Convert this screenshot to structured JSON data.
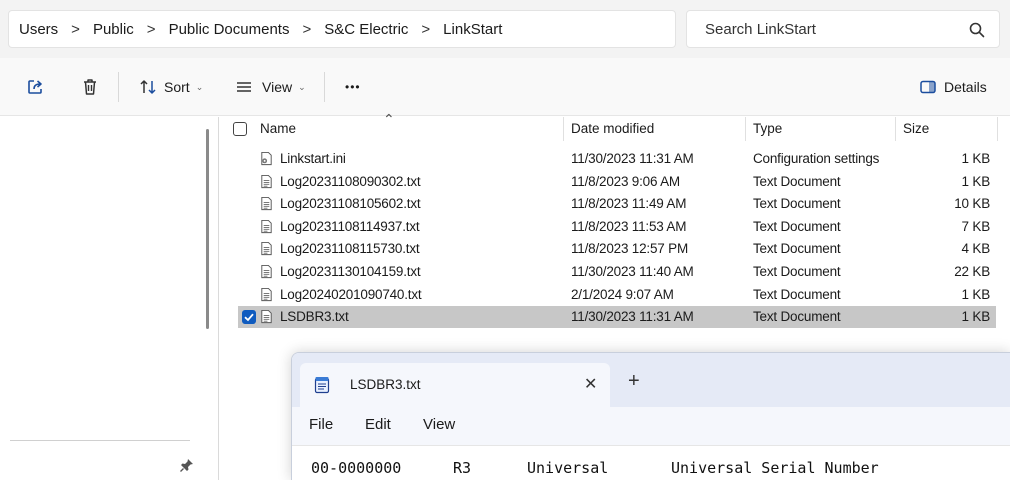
{
  "breadcrumb": [
    "Users",
    "Public",
    "Public Documents",
    "S&C Electric",
    "LinkStart"
  ],
  "breadcrumb_separator": ">",
  "search": {
    "placeholder": "Search LinkStart"
  },
  "toolbar": {
    "sort_label": "Sort",
    "view_label": "View",
    "more_label": "•••",
    "details_label": "Details"
  },
  "columns": {
    "name": "Name",
    "date": "Date modified",
    "type": "Type",
    "size": "Size"
  },
  "files": [
    {
      "name": "Linkstart.ini",
      "date": "11/30/2023 11:31 AM",
      "type": "Configuration settings",
      "size": "1 KB",
      "icon": "settings-file-icon"
    },
    {
      "name": "Log20231108090302.txt",
      "date": "11/8/2023 9:06 AM",
      "type": "Text Document",
      "size": "1 KB",
      "icon": "text-file-icon"
    },
    {
      "name": "Log20231108105602.txt",
      "date": "11/8/2023 11:49 AM",
      "type": "Text Document",
      "size": "10 KB",
      "icon": "text-file-icon"
    },
    {
      "name": "Log20231108114937.txt",
      "date": "11/8/2023 11:53 AM",
      "type": "Text Document",
      "size": "7 KB",
      "icon": "text-file-icon"
    },
    {
      "name": "Log20231108115730.txt",
      "date": "11/8/2023 12:57 PM",
      "type": "Text Document",
      "size": "4 KB",
      "icon": "text-file-icon"
    },
    {
      "name": "Log20231130104159.txt",
      "date": "11/30/2023 11:40 AM",
      "type": "Text Document",
      "size": "22 KB",
      "icon": "text-file-icon"
    },
    {
      "name": "Log20240201090740.txt",
      "date": "2/1/2024 9:07 AM",
      "type": "Text Document",
      "size": "1 KB",
      "icon": "text-file-icon"
    },
    {
      "name": "LSDBR3.txt",
      "date": "11/30/2023 11:31 AM",
      "type": "Text Document",
      "size": "1 KB",
      "icon": "text-file-icon",
      "selected": true
    }
  ],
  "notepad": {
    "tab_title": "LSDBR3.txt",
    "close_glyph": "✕",
    "new_tab_glyph": "+",
    "menu": [
      "File",
      "Edit",
      "View"
    ],
    "line1": [
      "00-0000000",
      "R3",
      "Universal",
      "Universal Serial Number"
    ]
  },
  "colors": {
    "selection": "#c7c7c7",
    "checkbox_checked": "#0f5bbf",
    "titlebar": "#e5eaf6",
    "chrome": "#f3f3f3"
  }
}
